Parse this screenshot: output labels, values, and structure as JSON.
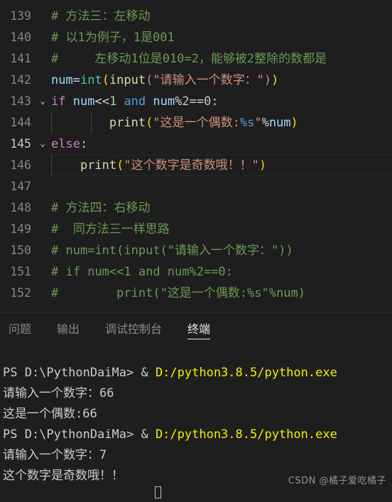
{
  "editor": {
    "background": "#1e1e1e",
    "active_line": 145,
    "first_partial_line": "138",
    "lines": [
      {
        "num": "139",
        "fold": "",
        "text": "# 方法三：左移动"
      },
      {
        "num": "140",
        "fold": "",
        "text": "# 以1为例子，1是001"
      },
      {
        "num": "141",
        "fold": "",
        "text": "#     左移动1位是010=2，能够被2整除的数都是"
      },
      {
        "num": "142",
        "fold": "",
        "text": "num=int(input(\"请输入一个数字：\"))"
      },
      {
        "num": "143",
        "fold": "chevron-down",
        "text": "if num<<1 and num%2==0:"
      },
      {
        "num": "144",
        "fold": "",
        "text": "        print(\"这是一个偶数:%s\"%num)"
      },
      {
        "num": "145",
        "fold": "chevron-down",
        "text": "else:"
      },
      {
        "num": "146",
        "fold": "",
        "text": "    print(\"这个数字是奇数哦！！\")"
      },
      {
        "num": "147",
        "fold": "",
        "text": ""
      },
      {
        "num": "148",
        "fold": "",
        "text": "# 方法四：右移动"
      },
      {
        "num": "149",
        "fold": "",
        "text": "#  同方法三一样思路"
      },
      {
        "num": "150",
        "fold": "",
        "text": "# num=int(input(\"请输入一个数字：\"))"
      },
      {
        "num": "151",
        "fold": "",
        "text": "# if num<<1 and num%2==0:"
      },
      {
        "num": "152",
        "fold": "",
        "text": "#        print(\"这是一个偶数:%s\"%num)"
      }
    ],
    "colors": {
      "comment": "#6a9955",
      "keyword": "#c586c0",
      "variable": "#9cdcfe",
      "number": "#b5cea8",
      "builtin_blue": "#569cd6",
      "function": "#dcdcaa",
      "type": "#4ec9b0",
      "string": "#ce9178",
      "plain": "#d4d4d4",
      "line_number": "#858585",
      "active_line_number": "#c6c6c6"
    }
  },
  "panel": {
    "tabs": [
      {
        "label": "问题",
        "active": false
      },
      {
        "label": "输出",
        "active": false
      },
      {
        "label": "调试控制台",
        "active": false
      },
      {
        "label": "终端",
        "active": true
      }
    ]
  },
  "terminal": {
    "prompt_color": "#cccccc",
    "path_color": "#f0f000",
    "lines": [
      {
        "type": "command",
        "prompt": "PS D:\\PythonDaiMa> & ",
        "path": "D:/python3.8.5/python.exe"
      },
      {
        "type": "output",
        "text": "请输入一个数字：66"
      },
      {
        "type": "output",
        "text": "这是一个偶数:66"
      },
      {
        "type": "command",
        "prompt": "PS D:\\PythonDaiMa> & ",
        "path": "D:/python3.8.5/python.exe"
      },
      {
        "type": "output",
        "text": "请输入一个数字：7"
      },
      {
        "type": "output",
        "text": "这个数字是奇数哦！！"
      }
    ]
  },
  "watermark": {
    "text": "CSDN @橘子爱吃橘子"
  }
}
